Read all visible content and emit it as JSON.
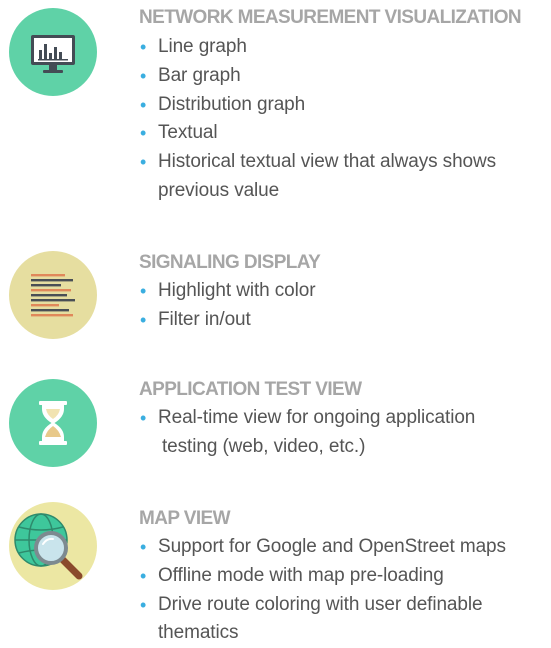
{
  "sections": [
    {
      "title": "NETWORK MEASUREMENT VISUALIZATION",
      "icon": "monitor-chart-icon",
      "color": "#5fd2a7",
      "items": [
        "Line graph",
        "Bar graph",
        "Distribution graph",
        "Textual",
        "Historical textual view that always shows",
        "previous value"
      ]
    },
    {
      "title": "SIGNALING DISPLAY",
      "icon": "text-lines-icon",
      "color": "#e6dea0",
      "items": [
        "Highlight with color",
        "Filter in/out"
      ]
    },
    {
      "title": "APPLICATION TEST VIEW",
      "icon": "hourglass-icon",
      "color": "#5fd2a7",
      "items": [
        "Real-time view for ongoing application",
        "testing (web, video, etc.)"
      ]
    },
    {
      "title": "MAP VIEW",
      "icon": "globe-magnifier-icon",
      "color": "#ece7a3",
      "items": [
        "Support for Google and OpenStreet maps",
        "Offline mode with map pre-loading",
        "Drive route coloring with user definable",
        "thematics"
      ]
    }
  ],
  "bullet_glyph": "•",
  "accent_color": "#3aaee0",
  "title_color": "#a6a6a6",
  "text_color": "#555555"
}
